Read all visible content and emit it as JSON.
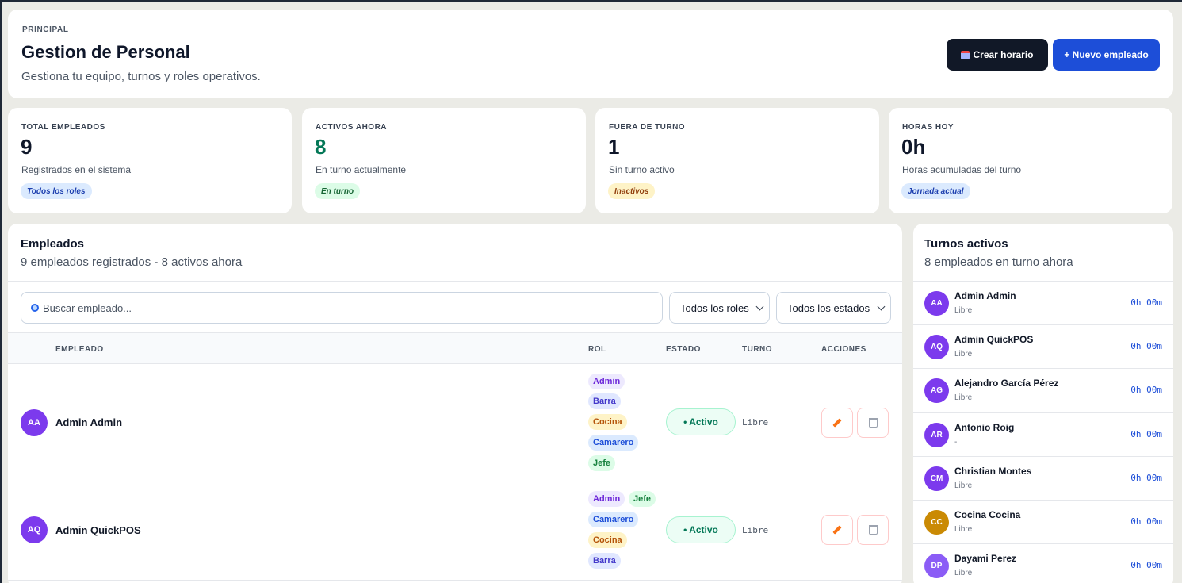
{
  "header": {
    "eyebrow": "PRINCIPAL",
    "title": "Gestion de Personal",
    "subtitle": "Gestiona tu equipo, turnos y roles operativos.",
    "btn_schedule": "Crear horario",
    "btn_new": "+ Nuevo empleado"
  },
  "stats": [
    {
      "label": "TOTAL EMPLEADOS",
      "value": "9",
      "desc": "Registrados en el sistema",
      "badge": "Todos los roles",
      "color": "#0f172a"
    },
    {
      "label": "ACTIVOS AHORA",
      "value": "8",
      "desc": "En turno actualmente",
      "badge": "En turno",
      "color": "#047857"
    },
    {
      "label": "FUERA DE TURNO",
      "value": "1",
      "desc": "Sin turno activo",
      "badge": "Inactivos",
      "color": "#0f172a"
    },
    {
      "label": "HORAS HOY",
      "value": "0h",
      "desc": "Horas acumuladas del turno",
      "badge": "Jornada actual",
      "color": "#0f172a"
    }
  ],
  "employees": {
    "title": "Empleados",
    "subtitle": "9 empleados registrados - 8 activos ahora",
    "search_placeholder": "Buscar empleado...",
    "filter_roles": "Todos los roles",
    "filter_states": "Todos los estados",
    "columns": {
      "employee": "EMPLEADO",
      "role": "ROL",
      "state": "ESTADO",
      "shift": "TURNO",
      "actions": "ACCIONES"
    },
    "rows": [
      {
        "initials": "AA",
        "name": "Admin Admin",
        "roles": [
          "Admin",
          "Barra",
          "Cocina",
          "Camarero",
          "Jefe"
        ],
        "state": "• Activo",
        "shift": "Libre"
      },
      {
        "initials": "AQ",
        "name": "Admin QuickPOS",
        "roles": [
          "Admin",
          "Jefe",
          "Camarero",
          "Cocina",
          "Barra"
        ],
        "state": "• Activo",
        "shift": "Libre"
      }
    ]
  },
  "turnos": {
    "title": "Turnos activos",
    "subtitle": "8 empleados en turno ahora",
    "items": [
      {
        "initials": "AA",
        "name": "Admin Admin",
        "sub": "Libre",
        "time": "0h 00m",
        "color": "#7c3aed"
      },
      {
        "initials": "AQ",
        "name": "Admin QuickPOS",
        "sub": "Libre",
        "time": "0h 00m",
        "color": "#7c3aed"
      },
      {
        "initials": "AG",
        "name": "Alejandro García Pérez",
        "sub": "Libre",
        "time": "0h 00m",
        "color": "#7c3aed"
      },
      {
        "initials": "AR",
        "name": "Antonio Roig",
        "sub": "-",
        "time": "0h 00m",
        "color": "#7c3aed"
      },
      {
        "initials": "CM",
        "name": "Christian Montes",
        "sub": "Libre",
        "time": "0h 00m",
        "color": "#7c3aed"
      },
      {
        "initials": "CC",
        "name": "Cocina Cocina",
        "sub": "Libre",
        "time": "0h 00m",
        "color": "#ca8a04"
      },
      {
        "initials": "DP",
        "name": "Dayami Perez",
        "sub": "Libre",
        "time": "0h 00m",
        "color": "#8b5cf6"
      }
    ]
  }
}
